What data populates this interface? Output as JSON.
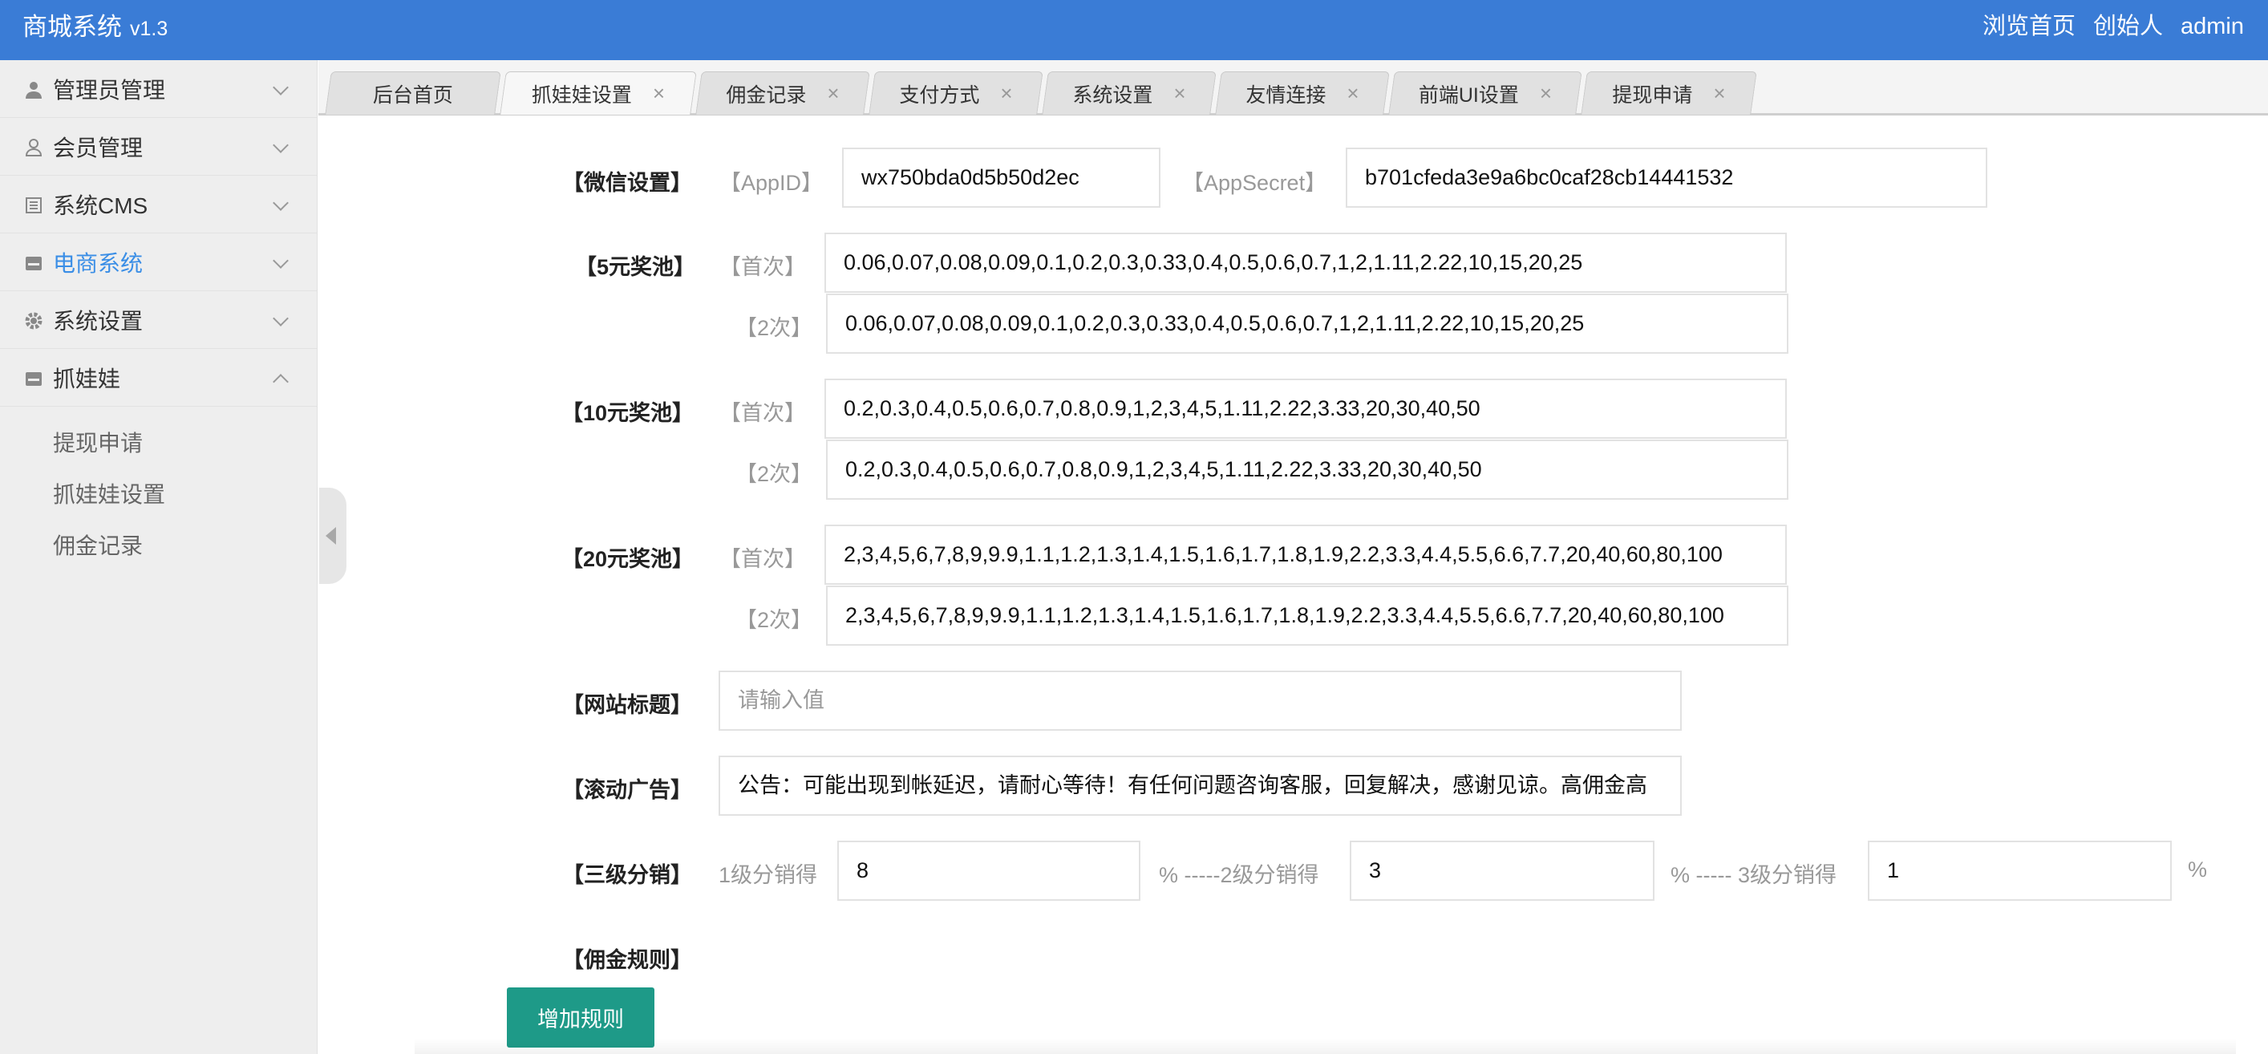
{
  "header": {
    "title": "商城系统",
    "version": "v1.3",
    "links": [
      "浏览首页",
      "创始人",
      "admin"
    ]
  },
  "sidebar": {
    "items": [
      {
        "label": "管理员管理",
        "icon": "user-icon"
      },
      {
        "label": "会员管理",
        "icon": "member-icon"
      },
      {
        "label": "系统CMS",
        "icon": "document-icon"
      },
      {
        "label": "电商系统",
        "icon": "shop-icon"
      },
      {
        "label": "系统设置",
        "icon": "gear-icon"
      },
      {
        "label": "抓娃娃",
        "icon": "game-icon"
      }
    ],
    "sub_items": [
      "提现申请",
      "抓娃娃设置",
      "佣金记录"
    ]
  },
  "tabs": [
    "后台首页",
    "抓娃娃设置",
    "佣金记录",
    "支付方式",
    "系统设置",
    "友情连接",
    "前端UI设置",
    "提现申请"
  ],
  "form": {
    "wechat": {
      "label": "【微信设置】",
      "appid_label": "【AppID】",
      "appid": "wx750bda0d5b50d2ec",
      "secret_label": "【AppSecret】",
      "secret": "b701cfeda3e9a6bc0caf28cb14441532"
    },
    "first_label": "【首次】",
    "second_label": "【2次】",
    "pool5": {
      "label": "【5元奖池】",
      "first": "0.06,0.07,0.08,0.09,0.1,0.2,0.3,0.33,0.4,0.5,0.6,0.7,1,2,1.11,2.22,10,15,20,25",
      "second": "0.06,0.07,0.08,0.09,0.1,0.2,0.3,0.33,0.4,0.5,0.6,0.7,1,2,1.11,2.22,10,15,20,25"
    },
    "pool10": {
      "label": "【10元奖池】",
      "first": "0.2,0.3,0.4,0.5,0.6,0.7,0.8,0.9,1,2,3,4,5,1.11,2.22,3.33,20,30,40,50",
      "second": "0.2,0.3,0.4,0.5,0.6,0.7,0.8,0.9,1,2,3,4,5,1.11,2.22,3.33,20,30,40,50"
    },
    "pool20": {
      "label": "【20元奖池】",
      "first": "2,3,4,5,6,7,8,9,9.9,1.1,1.2,1.3,1.4,1.5,1.6,1.7,1.8,1.9,2.2,3.3,4.4,5.5,6.6,7.7,20,40,60,80,100",
      "second": "2,3,4,5,6,7,8,9,9.9,1.1,1.2,1.3,1.4,1.5,1.6,1.7,1.8,1.9,2.2,3.3,4.4,5.5,6.6,7.7,20,40,60,80,100"
    },
    "site_title": {
      "label": "【网站标题】",
      "placeholder": "请输入值",
      "value": ""
    },
    "marquee": {
      "label": "【滚动广告】",
      "value": "公告：可能出现到帐延迟，请耐心等待！有任何问题咨询客服，回复解决，感谢见谅。高佣金高"
    },
    "distribution": {
      "label": "【三级分销】",
      "level1_label": "1级分销得",
      "level1": "8",
      "level2_label": "% -----2级分销得",
      "level2": "3",
      "level3_label": "% ----- 3级分销得",
      "level3": "1",
      "suffix": "%"
    },
    "commission_rules_label": "【佣金规则】",
    "add_rule_button": "增加规则"
  },
  "colors": {
    "header": "#3a7cd6",
    "active_nav": "#3a8ee6",
    "button": "#1e9a88"
  }
}
